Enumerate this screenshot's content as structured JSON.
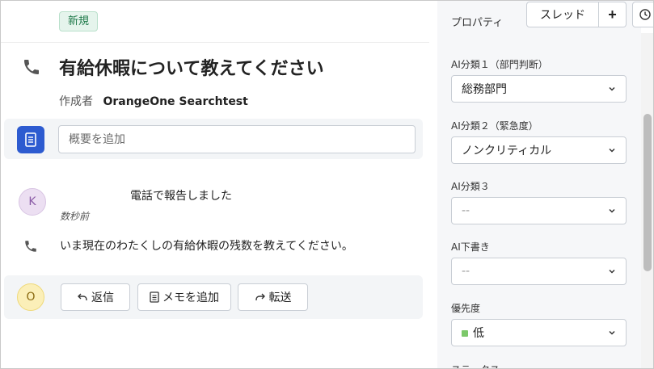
{
  "ticket": {
    "badge": "新規",
    "title": "有給休暇について教えてください",
    "author_label": "作成者",
    "author_name": "OrangeOne Searchtest"
  },
  "summary": {
    "placeholder": "概要を追加"
  },
  "activity": {
    "avatar_letter": "K",
    "message": "電話で報告しました",
    "time": "数秒前",
    "body": "いま現在のわたくしの有給休暇の残数を教えてください。"
  },
  "actions": {
    "avatar_letter": "O",
    "reply": "返信",
    "add_memo": "メモを追加",
    "forward": "転送"
  },
  "toolbar": {
    "thread": "スレッド",
    "plus": "+"
  },
  "properties": {
    "title": "プロパティ",
    "fields": [
      {
        "label": "AI分類１（部門判断）",
        "value": "総務部門"
      },
      {
        "label": "AI分類２（緊急度）",
        "value": "ノンクリティカル"
      },
      {
        "label": "AI分類３",
        "value": "--"
      },
      {
        "label": "AI下書き",
        "value": "--"
      },
      {
        "label": "優先度",
        "value": "低",
        "color": "#7cc86a"
      }
    ],
    "next_label": "ステータス"
  }
}
